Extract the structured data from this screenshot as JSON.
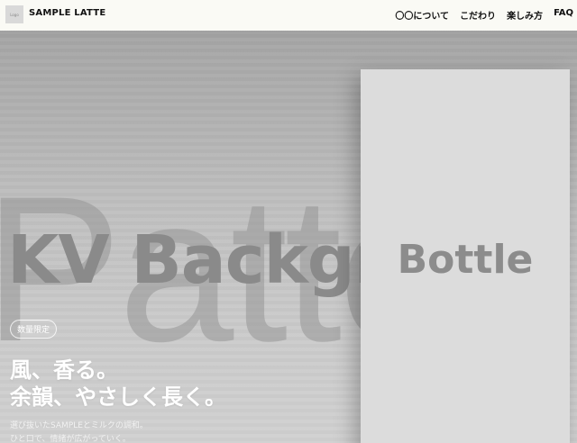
{
  "header": {
    "logo_text": "Logo",
    "brand": "SAMPLE LATTE",
    "nav": [
      {
        "label": "〇〇について"
      },
      {
        "label": "こだわり"
      },
      {
        "label": "楽しみ方"
      },
      {
        "label": "FAQ"
      }
    ]
  },
  "hero": {
    "pattern_text": "Patte",
    "kv_text": "KV Backgr",
    "bottle_text": "Bottle",
    "badge": "数量限定",
    "headline_line1": "風、香る。",
    "headline_line2": "余韻、やさしく長く。",
    "sub_line1": "選び抜いたSAMPLEとミルクの調和。",
    "sub_line2": "ひと口で、情緒が広がっていく。"
  },
  "colors": {
    "header_bg": "#fafaf5",
    "hero_bg": "#b2b2b2",
    "bottle_bg": "#dcdcdc",
    "text_white": "#ffffff"
  }
}
